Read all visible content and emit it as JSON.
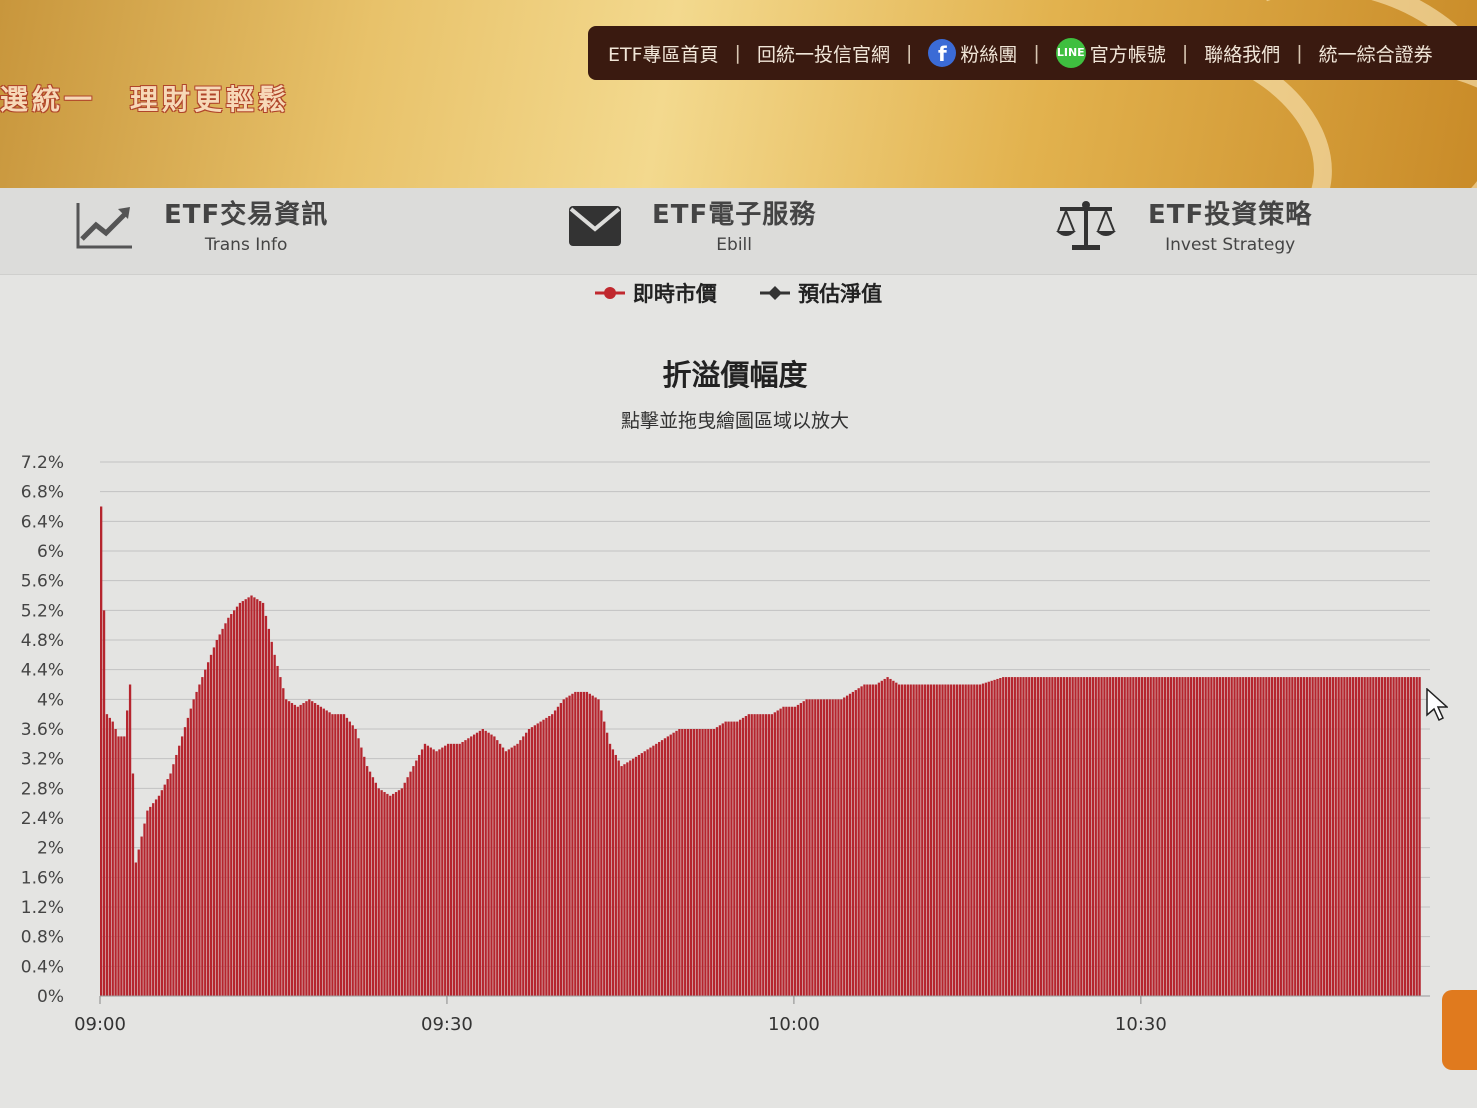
{
  "banner": {
    "slogan_left": "選統一",
    "slogan_right": "理財更輕鬆"
  },
  "topnav": {
    "items": [
      "ETF專區首頁",
      "回統一投信官網",
      "粉絲團",
      "官方帳號",
      "聯絡我們",
      "統一綜合證券"
    ],
    "separator": "|",
    "icons": [
      "facebook-icon",
      "line-icon"
    ]
  },
  "services": [
    {
      "title": "ETF交易資訊",
      "sub": "Trans Info",
      "icon": "chart-up-icon"
    },
    {
      "title": "ETF電子服務",
      "sub": "Ebill",
      "icon": "envelope-icon"
    },
    {
      "title": "ETF投資策略",
      "sub": "Invest Strategy",
      "icon": "scale-icon"
    }
  ],
  "chart_data": {
    "type": "bar",
    "title": "折溢價幅度",
    "subtitle": "點擊並拖曳繪圖區域以放大",
    "legend": [
      {
        "name": "即時市價",
        "color": "#c0282e",
        "marker": "circle"
      },
      {
        "name": "預估淨值",
        "color": "#333333",
        "marker": "diamond"
      }
    ],
    "bar_color": "#b5252e",
    "x_ticks": [
      "09:00",
      "09:30",
      "10:00",
      "10:30"
    ],
    "x_tick_minutes": [
      0,
      30,
      60,
      90
    ],
    "xlim": [
      0,
      115
    ],
    "y_ticks": [
      "0%",
      "0.4%",
      "0.8%",
      "1.2%",
      "1.6%",
      "2%",
      "2.4%",
      "2.8%",
      "3.2%",
      "3.6%",
      "4%",
      "4.4%",
      "4.8%",
      "5.2%",
      "5.6%",
      "6%",
      "6.4%",
      "6.8%",
      "7.2%"
    ],
    "ylim": [
      0,
      7.2
    ],
    "grid": true,
    "series": [
      {
        "x": [
          0,
          0.5,
          1,
          1.5,
          2,
          2.5,
          3,
          4,
          5,
          6,
          7,
          8,
          9,
          10,
          11,
          12,
          13,
          14,
          15,
          16,
          17,
          18,
          19,
          20,
          21,
          22,
          23,
          24,
          25,
          26,
          27,
          28,
          29,
          30,
          31,
          32,
          33,
          34,
          35,
          36,
          37,
          38,
          39,
          40,
          41,
          42,
          43,
          44,
          45,
          46,
          47,
          48,
          49,
          50,
          51,
          52,
          53,
          54,
          55,
          56,
          57,
          58,
          59,
          60,
          61,
          62,
          63,
          64,
          65,
          66,
          67,
          68,
          69,
          70,
          72,
          74,
          76,
          78,
          80,
          82,
          84,
          86,
          88,
          90,
          92,
          94,
          96,
          98,
          100,
          102,
          104,
          106,
          108,
          110,
          112,
          114
        ],
        "values": [
          6.6,
          3.8,
          3.7,
          3.5,
          3.5,
          4.2,
          1.8,
          2.5,
          2.7,
          3.0,
          3.5,
          4.0,
          4.4,
          4.8,
          5.1,
          5.3,
          5.4,
          5.3,
          4.6,
          4.0,
          3.9,
          4.0,
          3.9,
          3.8,
          3.8,
          3.6,
          3.1,
          2.8,
          2.7,
          2.8,
          3.1,
          3.4,
          3.3,
          3.4,
          3.4,
          3.5,
          3.6,
          3.5,
          3.3,
          3.4,
          3.6,
          3.7,
          3.8,
          4.0,
          4.1,
          4.1,
          4.0,
          3.4,
          3.1,
          3.2,
          3.3,
          3.4,
          3.5,
          3.6,
          3.6,
          3.6,
          3.6,
          3.7,
          3.7,
          3.8,
          3.8,
          3.8,
          3.9,
          3.9,
          4.0,
          4.0,
          4.0,
          4.0,
          4.1,
          4.2,
          4.2,
          4.3,
          4.2,
          4.2,
          4.2,
          4.2,
          4.2,
          4.3,
          4.3,
          4.3,
          4.3,
          4.3,
          4.3,
          4.3,
          4.3,
          4.3,
          4.3,
          4.3,
          4.3,
          4.3,
          4.3,
          4.3,
          4.3,
          4.3,
          4.3,
          4.3
        ]
      }
    ]
  }
}
